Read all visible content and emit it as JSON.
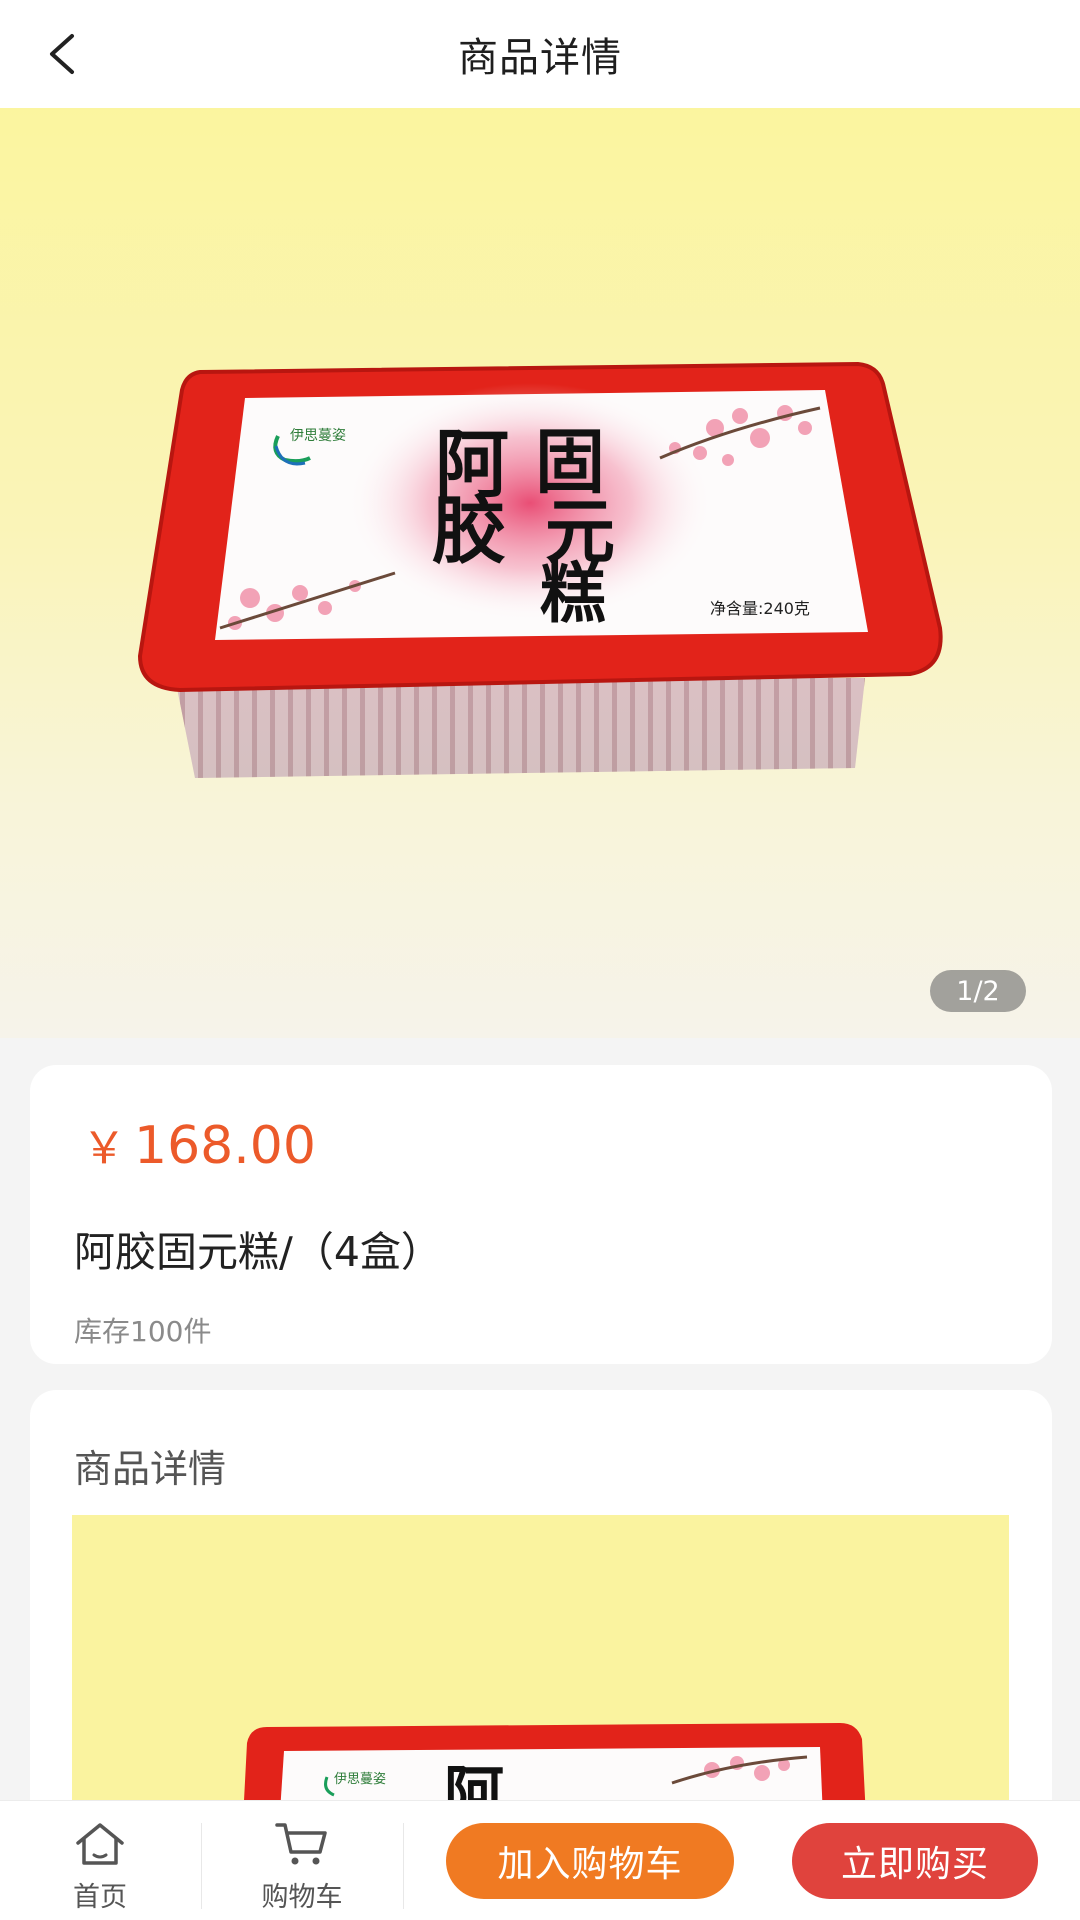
{
  "header": {
    "title": "商品详情",
    "back_icon": "chevron-left-icon"
  },
  "gallery": {
    "pager": "1/2",
    "box_label": {
      "brand": "伊思蔓姿",
      "chars": [
        "阿",
        "胶",
        "固",
        "元",
        "糕"
      ],
      "net_weight": "净含量:240克"
    }
  },
  "product": {
    "currency_symbol": "￥",
    "price": "168.00",
    "name": "阿胶固元糕/（4盒）",
    "stock": "库存100件"
  },
  "detail": {
    "title": "商品详情"
  },
  "bottom_bar": {
    "home_label": "首页",
    "cart_label": "购物车",
    "add_to_cart": "加入购物车",
    "buy_now": "立即购买"
  },
  "colors": {
    "accent_price": "#ec5a2a",
    "add_to_cart_bg": "#f07a22",
    "buy_now_bg": "#e0433d",
    "box_red": "#e2231a"
  }
}
